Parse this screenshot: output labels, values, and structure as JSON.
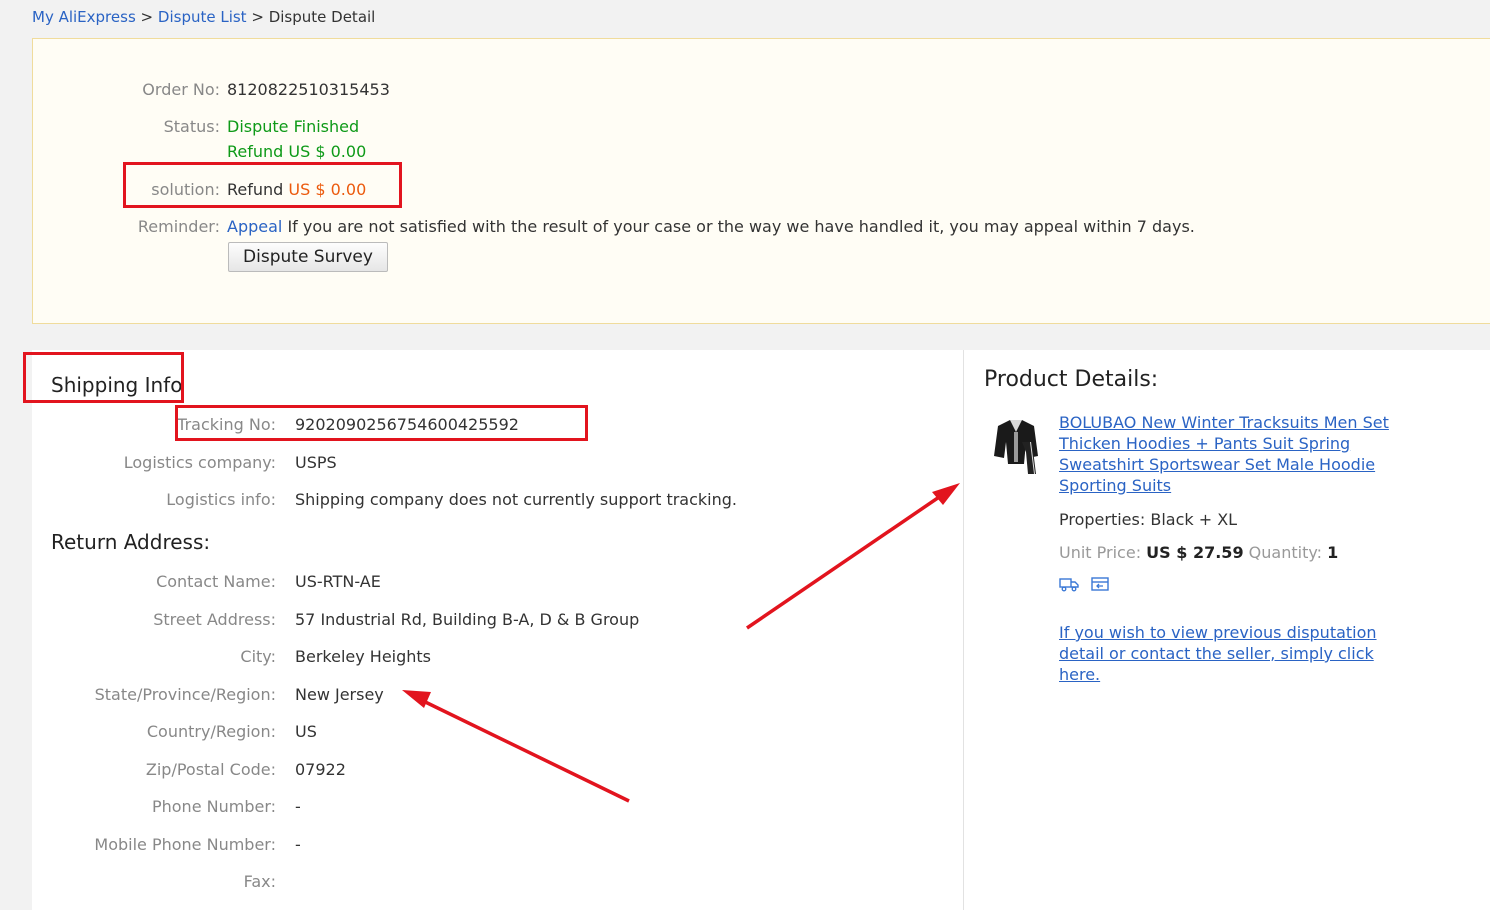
{
  "breadcrumb": {
    "home": "My AliExpress",
    "sep1": ">",
    "list": "Dispute List",
    "sep2": ">",
    "current": "Dispute Detail"
  },
  "summary": {
    "order_label": "Order No:",
    "order_no": "8120822510315453",
    "status_label": "Status:",
    "status_value": "Dispute Finished",
    "status_refund": "Refund US $ 0.00",
    "solution_label": "solution:",
    "solution_text": "Refund",
    "solution_amount": "US $ 0.00",
    "reminder_label": "Reminder:",
    "appeal_link": "Appeal",
    "reminder_text": "If you are not satisfied with the result of your case or the way we have handled it, you may appeal within 7 days.",
    "survey_button": "Dispute Survey"
  },
  "shipping": {
    "title": "Shipping Info",
    "tracking_label": "Tracking No:",
    "tracking_no": "9202090256754600425592",
    "company_label": "Logistics company:",
    "company": "USPS",
    "info_label": "Logistics info:",
    "info": "Shipping company does not currently support tracking."
  },
  "return_address": {
    "title": "Return Address:",
    "fields": [
      {
        "label": "Contact Name:",
        "value": "US-RTN-AE"
      },
      {
        "label": "Street Address:",
        "value": "57 Industrial Rd, Building B-A, D & B Group"
      },
      {
        "label": "City:",
        "value": "Berkeley Heights"
      },
      {
        "label": "State/Province/Region:",
        "value": "New Jersey"
      },
      {
        "label": "Country/Region:",
        "value": "US"
      },
      {
        "label": "Zip/Postal Code:",
        "value": "07922"
      },
      {
        "label": "Phone Number:",
        "value": "-"
      },
      {
        "label": "Mobile Phone Number:",
        "value": "-"
      },
      {
        "label": "Fax:",
        "value": ""
      }
    ]
  },
  "product": {
    "title": "Product Details:",
    "name": "BOLUBAO New Winter Tracksuits Men Set Thicken Hoodies + Pants Suit Spring Sweatshirt Sportswear Set Male Hoodie Sporting Suits",
    "properties_label": "Properties:",
    "properties": "Black + XL",
    "unit_price_label": "Unit Price:",
    "unit_price": "US $ 27.59",
    "quantity_label": "Quantity:",
    "quantity": "1",
    "icons": [
      "shipping-truck-icon",
      "return-box-icon"
    ],
    "contact_text": "If you wish to view previous disputation detail or contact the seller, simply click here."
  },
  "colors": {
    "link": "#2a63c4",
    "status_green": "#0e9a18",
    "amount_orange": "#ec5a0d",
    "annotation_red": "#e2141e"
  }
}
